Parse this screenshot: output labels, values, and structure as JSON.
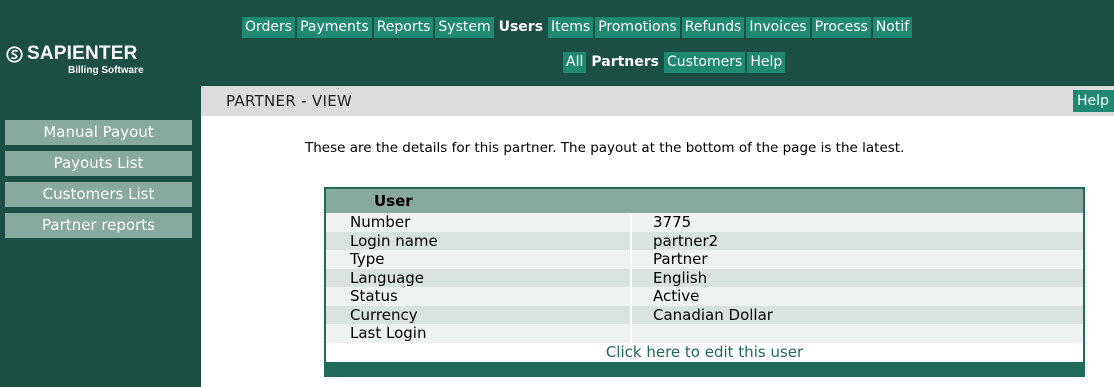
{
  "brand": {
    "name": "SAPIENTER",
    "tagline": "Billing Software",
    "logo_icon": "swirl-logo-icon"
  },
  "nav": {
    "main_tabs": [
      "Orders",
      "Payments",
      "Reports",
      "System",
      "Users",
      "Items",
      "Promotions",
      "Refunds",
      "Invoices",
      "Process",
      "Notif"
    ],
    "active_main": "Users",
    "sub_tabs": [
      "All",
      "Partners",
      "Customers",
      "Help"
    ],
    "active_sub": "Partners"
  },
  "sidebar": {
    "items": [
      {
        "label": "Manual Payout"
      },
      {
        "label": "Payouts List"
      },
      {
        "label": "Customers List"
      },
      {
        "label": "Partner reports"
      }
    ]
  },
  "page": {
    "title": "PARTNER - VIEW",
    "help_label": "Help",
    "intro": "These are the details for this partner. The payout at the bottom of the page is the latest."
  },
  "user_table": {
    "header": "User",
    "rows": [
      {
        "label": "Number",
        "value": "3775"
      },
      {
        "label": "Login name",
        "value": "partner2"
      },
      {
        "label": "Type",
        "value": "Partner"
      },
      {
        "label": "Language",
        "value": "English"
      },
      {
        "label": "Status",
        "value": "Active"
      },
      {
        "label": "Currency",
        "value": "Canadian Dollar"
      },
      {
        "label": "Last Login",
        "value": ""
      }
    ],
    "edit_link": "Click here to edit this user"
  },
  "colors": {
    "dark_green": "#1c4f43",
    "tab_green": "#1f8870",
    "sage": "#87a99e",
    "title_gray": "#dcdcdc"
  }
}
